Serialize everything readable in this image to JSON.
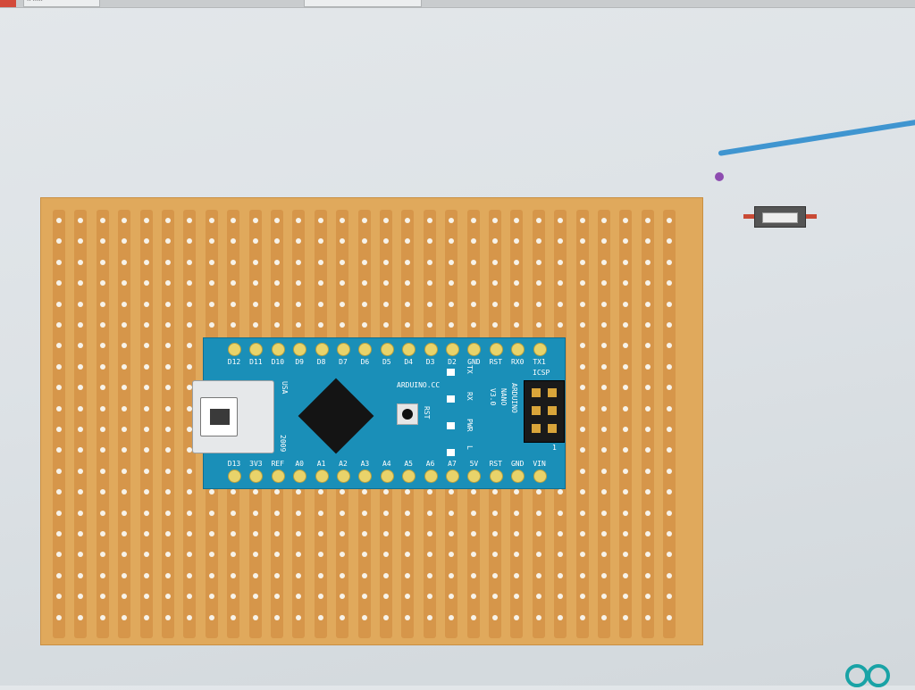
{
  "window": {
    "tab_label": "·· ·····",
    "accent": "#d34a3a"
  },
  "board": {
    "color": "#e0a95c",
    "strip_color": "#d6964a",
    "columns": 29,
    "rows": 20
  },
  "arduino": {
    "top_pins": [
      "D12",
      "D11",
      "D10",
      "D9",
      "D8",
      "D7",
      "D6",
      "D5",
      "D4",
      "D3",
      "D2",
      "GND",
      "RST",
      "RX0",
      "TX1"
    ],
    "bottom_pins": [
      "D13",
      "3V3",
      "REF",
      "A0",
      "A1",
      "A2",
      "A3",
      "A4",
      "A5",
      "A6",
      "A7",
      "5V",
      "RST",
      "GND",
      "VIN"
    ],
    "usa_label": "USA",
    "year_label": "2009",
    "site_label": "ARDUINO.CC",
    "reset_label": "RST",
    "led_labels": [
      "TX",
      "RX",
      "PWR",
      "L"
    ],
    "model_lines": [
      "ARDUINO",
      "NANO",
      "V3.0"
    ],
    "icsp_label": "ICSP",
    "icsp_pin1": "1",
    "color": "#1a8fb8"
  },
  "parts": {
    "wire_color": "#3f95d0",
    "switch_lead_color": "#c94a35"
  }
}
